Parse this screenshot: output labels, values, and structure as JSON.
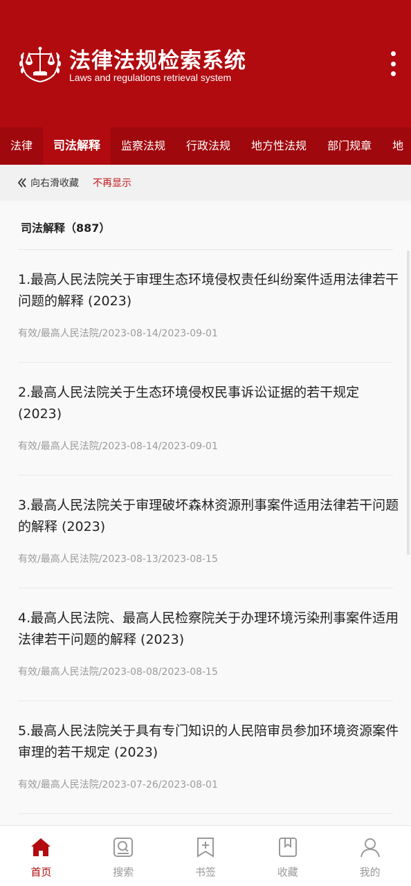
{
  "header": {
    "title_cn": "法律法规检索系统",
    "title_en": "Laws and regulations retrieval system",
    "brand_color": "#b10a0f"
  },
  "tabs": [
    {
      "label": "法律",
      "active": false
    },
    {
      "label": "司法解释",
      "active": true
    },
    {
      "label": "监察法规",
      "active": false
    },
    {
      "label": "行政法规",
      "active": false
    },
    {
      "label": "地方性法规",
      "active": false
    },
    {
      "label": "部门规章",
      "active": false
    },
    {
      "label": "地",
      "active": false
    }
  ],
  "hint": {
    "icon": "double-chevron-left-icon",
    "text": "向右滑收藏",
    "dismiss": "不再显示"
  },
  "section": {
    "title": "司法解释（887）"
  },
  "items": [
    {
      "title": "1.最高人民法院关于审理生态环境侵权责任纠纷案件适用法律若干问题的解释 (2023)",
      "meta": "有效/最高人民法院/2023-08-14/2023-09-01"
    },
    {
      "title": "2.最高人民法院关于生态环境侵权民事诉讼证据的若干规定 (2023)",
      "meta": "有效/最高人民法院/2023-08-14/2023-09-01"
    },
    {
      "title": "3.最高人民法院关于审理破坏森林资源刑事案件适用法律若干问题的解释 (2023)",
      "meta": "有效/最高人民法院/2023-08-13/2023-08-15"
    },
    {
      "title": "4.最高人民法院、最高人民检察院关于办理环境污染刑事案件适用法律若干问题的解释 (2023)",
      "meta": "有效/最高人民法院/2023-08-08/2023-08-15"
    },
    {
      "title": "5.最高人民法院关于具有专门知识的人民陪审员参加环境资源案件审理的若干规定 (2023)",
      "meta": "有效/最高人民法院/2023-07-26/2023-08-01"
    }
  ],
  "bottom_nav": [
    {
      "label": "首页",
      "icon": "home-icon",
      "active": true
    },
    {
      "label": "搜索",
      "icon": "search-icon",
      "active": false
    },
    {
      "label": "书签",
      "icon": "bookmark-add-icon",
      "active": false
    },
    {
      "label": "收藏",
      "icon": "book-favorite-icon",
      "active": false
    },
    {
      "label": "我的",
      "icon": "user-icon",
      "active": false
    }
  ]
}
